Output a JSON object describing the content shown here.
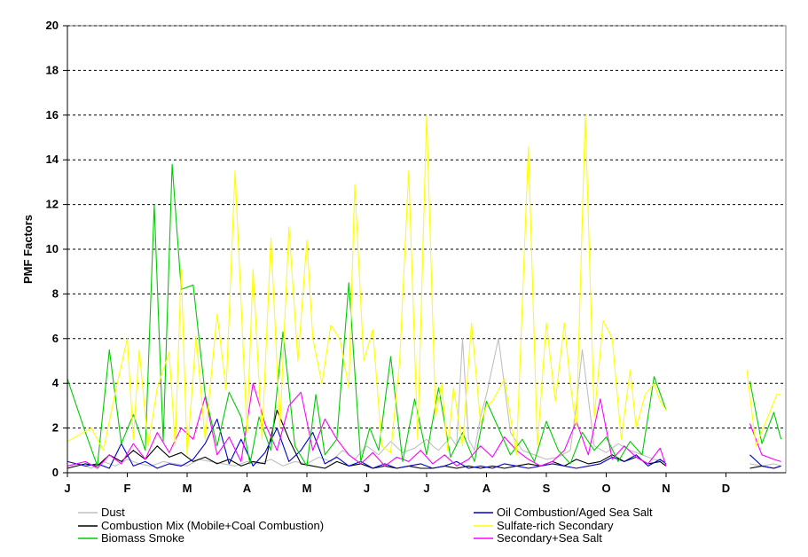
{
  "chart_data": {
    "type": "line",
    "ylabel": "PMF Factors",
    "ylim": [
      0,
      20
    ],
    "yticks": [
      0,
      2,
      4,
      6,
      8,
      10,
      12,
      14,
      16,
      18,
      20
    ],
    "xlim": [
      0,
      12
    ],
    "months": [
      "J",
      "F",
      "M",
      "A",
      "M",
      "J",
      "J",
      "A",
      "S",
      "O",
      "N",
      "D"
    ],
    "grid": "horizontal-dashed",
    "legend_position": "bottom",
    "series": [
      {
        "name": "Dust",
        "color": "#c0c0c0",
        "x": [
          0.0,
          0.2,
          0.4,
          0.6,
          0.8,
          1.0,
          1.2,
          1.4,
          1.6,
          1.8,
          2.0,
          2.2,
          2.4,
          2.6,
          2.8,
          3.0,
          3.2,
          3.4,
          3.6,
          3.8,
          4.0,
          4.2,
          4.4,
          4.6,
          4.8,
          5.0,
          5.2,
          5.4,
          5.6,
          5.8,
          6.0,
          6.1,
          6.2,
          6.3,
          6.4,
          6.5,
          6.6,
          6.7,
          6.8,
          6.9,
          7.0,
          7.2,
          7.4,
          7.6,
          7.8,
          8.0,
          8.2,
          8.4,
          8.5,
          8.6,
          8.8,
          9.0,
          9.2,
          9.4,
          9.6,
          9.8,
          10.0,
          11.4,
          11.6,
          11.8,
          11.92
        ],
        "y": [
          0.3,
          0.4,
          0.2,
          0.5,
          0.3,
          0.6,
          0.4,
          0.3,
          0.5,
          0.4,
          0.3,
          0.6,
          0.5,
          0.4,
          0.3,
          0.5,
          0.4,
          0.6,
          0.3,
          0.5,
          0.4,
          0.7,
          0.5,
          1.0,
          0.6,
          1.2,
          0.8,
          1.4,
          0.9,
          1.1,
          1.5,
          1.2,
          1.0,
          1.3,
          1.6,
          1.2,
          6.0,
          1.5,
          1.0,
          2.5,
          3.5,
          6.0,
          1.8,
          1.0,
          0.8,
          0.6,
          0.7,
          1.0,
          3.0,
          5.5,
          1.2,
          0.9,
          1.3,
          1.0,
          0.8,
          0.6,
          0.5,
          0.4,
          0.3,
          0.4,
          0.3
        ]
      },
      {
        "name": "Combustion Mix (Mobile+Coal Combustion)",
        "color": "#000000",
        "x": [
          0.0,
          0.3,
          0.5,
          0.7,
          0.9,
          1.1,
          1.3,
          1.5,
          1.7,
          1.9,
          2.1,
          2.3,
          2.5,
          2.7,
          2.9,
          3.1,
          3.3,
          3.5,
          3.7,
          3.9,
          4.1,
          4.3,
          4.5,
          4.7,
          4.9,
          5.1,
          5.3,
          5.5,
          5.7,
          5.9,
          6.1,
          6.3,
          6.5,
          6.7,
          6.9,
          7.1,
          7.3,
          7.5,
          7.7,
          7.9,
          8.1,
          8.3,
          8.5,
          8.7,
          8.9,
          9.1,
          9.3,
          9.5,
          9.7,
          9.9,
          10.0,
          11.4,
          11.6,
          11.8,
          11.92
        ],
        "y": [
          0.2,
          0.4,
          0.3,
          0.8,
          0.5,
          1.0,
          0.6,
          1.2,
          0.7,
          0.9,
          0.5,
          0.7,
          0.4,
          0.6,
          0.3,
          0.5,
          0.4,
          2.8,
          1.5,
          0.4,
          0.3,
          0.2,
          0.5,
          0.3,
          0.4,
          0.2,
          0.3,
          0.2,
          0.3,
          0.2,
          0.2,
          0.3,
          0.2,
          0.3,
          0.2,
          0.3,
          0.2,
          0.3,
          0.4,
          0.3,
          0.5,
          0.3,
          0.6,
          0.4,
          0.5,
          0.8,
          0.5,
          0.7,
          0.4,
          0.5,
          0.3,
          0.2,
          0.3,
          0.2,
          0.3
        ]
      },
      {
        "name": "Biomass Smoke",
        "color": "#00cc00",
        "x": [
          0.0,
          0.3,
          0.5,
          0.7,
          0.9,
          1.1,
          1.3,
          1.45,
          1.6,
          1.75,
          1.9,
          2.1,
          2.3,
          2.5,
          2.7,
          2.9,
          3.05,
          3.2,
          3.4,
          3.6,
          3.8,
          4.0,
          4.15,
          4.3,
          4.5,
          4.7,
          4.9,
          5.05,
          5.2,
          5.4,
          5.6,
          5.8,
          6.0,
          6.2,
          6.4,
          6.6,
          6.8,
          7.0,
          7.2,
          7.4,
          7.6,
          7.8,
          8.0,
          8.2,
          8.4,
          8.6,
          8.8,
          9.0,
          9.2,
          9.4,
          9.6,
          9.8,
          10.0,
          11.4,
          11.6,
          11.8,
          11.92
        ],
        "y": [
          4.2,
          1.8,
          0.3,
          5.5,
          1.3,
          2.6,
          1.0,
          12.0,
          1.4,
          13.8,
          8.2,
          8.4,
          3.5,
          1.2,
          3.6,
          2.5,
          0.4,
          2.5,
          1.0,
          6.3,
          1.2,
          0.3,
          3.5,
          0.8,
          1.5,
          8.5,
          0.5,
          2.0,
          1.0,
          5.2,
          0.5,
          3.3,
          0.8,
          3.8,
          0.7,
          1.8,
          0.5,
          3.2,
          2.0,
          0.8,
          1.5,
          0.5,
          2.3,
          1.0,
          0.4,
          1.8,
          1.0,
          1.6,
          0.5,
          1.4,
          0.8,
          4.3,
          2.8,
          4.1,
          1.3,
          2.7,
          1.5
        ]
      },
      {
        "name": "Oil Combustion/Aged Sea Salt",
        "color": "#0000cc",
        "x": [
          0.0,
          0.3,
          0.5,
          0.7,
          0.9,
          1.1,
          1.3,
          1.5,
          1.7,
          1.9,
          2.1,
          2.3,
          2.5,
          2.7,
          2.9,
          3.1,
          3.3,
          3.5,
          3.7,
          3.9,
          4.1,
          4.3,
          4.5,
          4.7,
          4.9,
          5.1,
          5.3,
          5.5,
          5.7,
          5.9,
          6.1,
          6.3,
          6.5,
          6.7,
          6.9,
          7.1,
          7.3,
          7.5,
          7.7,
          7.9,
          8.1,
          8.3,
          8.5,
          8.7,
          8.9,
          9.1,
          9.3,
          9.5,
          9.7,
          9.9,
          10.0,
          11.4,
          11.6,
          11.8,
          11.92
        ],
        "y": [
          0.5,
          0.3,
          0.4,
          0.2,
          1.3,
          0.3,
          0.5,
          0.2,
          0.4,
          0.3,
          0.6,
          1.3,
          2.4,
          0.4,
          1.5,
          0.3,
          0.9,
          2.0,
          0.5,
          1.0,
          1.8,
          0.4,
          0.7,
          0.3,
          0.5,
          0.2,
          0.4,
          0.2,
          0.3,
          0.4,
          0.2,
          0.3,
          0.5,
          0.2,
          0.3,
          0.2,
          0.4,
          0.3,
          0.2,
          0.3,
          0.4,
          0.3,
          0.2,
          0.3,
          0.4,
          0.7,
          0.5,
          0.8,
          0.3,
          0.6,
          0.4,
          0.8,
          0.3,
          0.2,
          0.3
        ]
      },
      {
        "name": "Sulfate-rich Secondary",
        "color": "#ffff00",
        "x": [
          0.0,
          0.2,
          0.4,
          0.6,
          0.8,
          1.0,
          1.1,
          1.2,
          1.35,
          1.5,
          1.7,
          1.8,
          1.9,
          2.0,
          2.15,
          2.3,
          2.5,
          2.65,
          2.8,
          3.0,
          3.1,
          3.25,
          3.4,
          3.55,
          3.7,
          3.85,
          4.0,
          4.1,
          4.25,
          4.4,
          4.55,
          4.7,
          4.8,
          4.95,
          5.1,
          5.25,
          5.4,
          5.55,
          5.7,
          5.85,
          6.0,
          6.15,
          6.25,
          6.35,
          6.45,
          6.6,
          6.75,
          6.9,
          7.0,
          7.1,
          7.3,
          7.5,
          7.7,
          7.85,
          8.0,
          8.15,
          8.3,
          8.4,
          8.5,
          8.65,
          8.8,
          8.95,
          9.1,
          9.25,
          9.4,
          9.5,
          9.65,
          9.8,
          9.9,
          10.0,
          11.35,
          11.5,
          11.7,
          11.85,
          11.92
        ],
        "y": [
          1.4,
          1.7,
          2.0,
          1.0,
          3.6,
          6.0,
          1.5,
          5.5,
          1.2,
          3.8,
          5.4,
          1.2,
          9.1,
          0.8,
          6.1,
          1.5,
          7.1,
          3.7,
          13.5,
          1.8,
          9.1,
          1.5,
          10.5,
          2.0,
          11.0,
          5.0,
          10.4,
          6.0,
          4.0,
          6.6,
          6.0,
          3.8,
          12.9,
          5.0,
          6.4,
          1.2,
          0.9,
          5.0,
          13.5,
          1.5,
          16.0,
          2.5,
          4.0,
          1.0,
          3.8,
          1.2,
          6.7,
          2.2,
          3.0,
          3.2,
          4.2,
          0.8,
          14.6,
          1.2,
          6.7,
          3.2,
          6.7,
          4.0,
          2.0,
          16.0,
          2.5,
          6.8,
          6.0,
          1.5,
          4.6,
          2.0,
          3.5,
          4.0,
          3.2,
          2.8,
          4.6,
          1.2,
          2.5,
          3.5,
          3.5
        ]
      },
      {
        "name": "Secondary+Sea Salt",
        "color": "#ff00ff",
        "x": [
          0.0,
          0.3,
          0.5,
          0.7,
          0.9,
          1.1,
          1.3,
          1.5,
          1.7,
          1.9,
          2.1,
          2.3,
          2.5,
          2.7,
          2.9,
          3.1,
          3.3,
          3.5,
          3.7,
          3.9,
          4.1,
          4.3,
          4.5,
          4.7,
          4.9,
          5.1,
          5.3,
          5.5,
          5.7,
          5.9,
          6.1,
          6.3,
          6.5,
          6.7,
          6.9,
          7.1,
          7.3,
          7.5,
          7.7,
          7.9,
          8.1,
          8.3,
          8.5,
          8.7,
          8.9,
          9.1,
          9.3,
          9.5,
          9.7,
          9.9,
          10.0,
          11.4,
          11.6,
          11.8,
          11.92
        ],
        "y": [
          0.3,
          0.5,
          0.2,
          0.8,
          0.4,
          1.3,
          0.6,
          1.8,
          0.9,
          2.0,
          1.5,
          3.4,
          0.8,
          1.6,
          0.5,
          4.0,
          2.2,
          1.0,
          3.0,
          3.6,
          1.0,
          2.4,
          1.5,
          0.8,
          0.4,
          0.9,
          0.3,
          0.7,
          0.5,
          1.0,
          0.4,
          0.8,
          0.3,
          0.6,
          1.2,
          0.7,
          1.6,
          1.0,
          0.6,
          0.3,
          0.5,
          1.0,
          2.3,
          0.8,
          3.3,
          0.6,
          1.2,
          0.7,
          0.4,
          1.1,
          0.3,
          2.2,
          0.8,
          0.6,
          0.5
        ]
      }
    ]
  }
}
